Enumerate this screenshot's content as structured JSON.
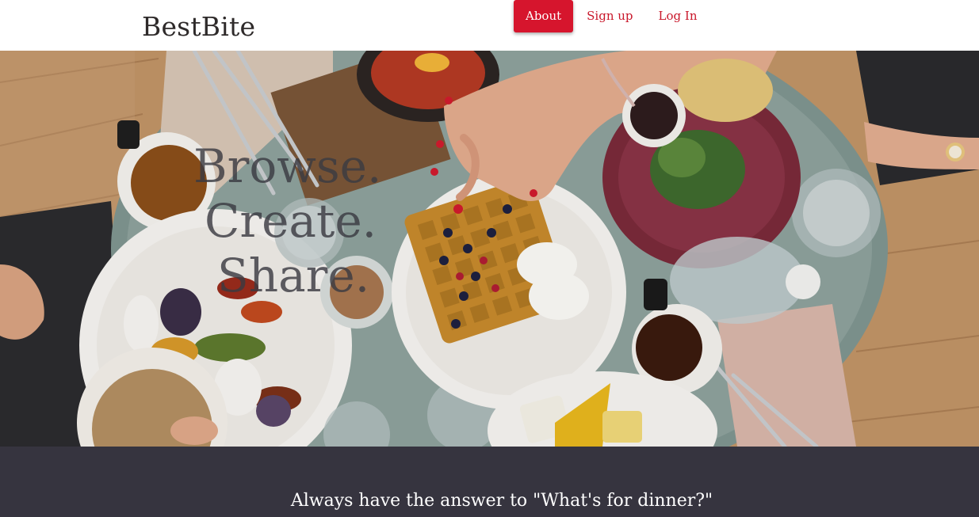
{
  "header": {
    "brand": "BestBite",
    "nav": [
      {
        "label": "About",
        "active": true
      },
      {
        "label": "Sign up",
        "active": false
      },
      {
        "label": "Log In",
        "active": false
      }
    ]
  },
  "hero": {
    "tagline": [
      "Browse.",
      "Create.",
      "Share."
    ],
    "image": "overhead-brunch-table-photo"
  },
  "band": {
    "text": "Always have the answer to \"What's for dinner?\""
  },
  "colors": {
    "accent": "#d6152d",
    "nav_link": "#c9182b",
    "band_bg": "#36343f",
    "brand_text": "#2e2a2a"
  }
}
